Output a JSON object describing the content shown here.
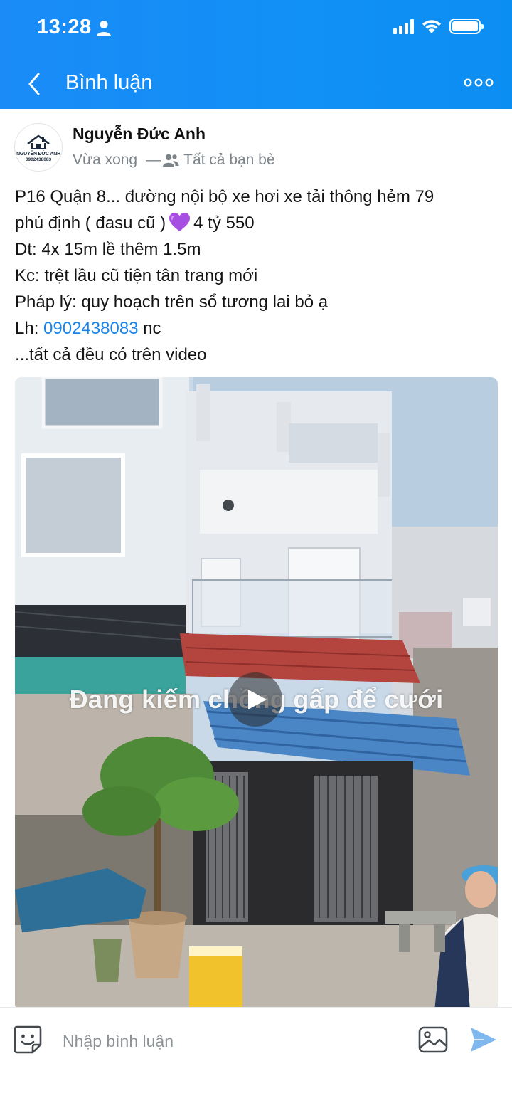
{
  "status_bar": {
    "time": "13:28"
  },
  "nav": {
    "title": "Bình luận"
  },
  "post": {
    "avatar": {
      "brand_text": "NGUYỄN ĐỨC ANH",
      "phone_text": "0902438083"
    },
    "author": "Nguyễn Đức Anh",
    "timestamp": "Vừa xong",
    "audience": "Tất cả bạn bè",
    "text": {
      "line1": "P16 Quận 8... đường nội bộ xe hơi xe tải thông hẻm 79",
      "line2_before": "phú định ( đasu cũ )",
      "line2_after": "4 tỷ 550",
      "line3": "Dt: 4x 15m lề thêm 1.5m",
      "line4": "Kc: trệt lầu cũ tiện tân trang mới",
      "line5": "Pháp lý: quy hoạch trên sổ tương lai bỏ ạ",
      "line6_prefix": "Lh: ",
      "phone": "0902438083",
      "line6_suffix": " nc",
      "line7": "...tất cả đều có trên video"
    },
    "video": {
      "caption": "Đang kiếm chồng gấp để cưới"
    }
  },
  "comment_bar": {
    "placeholder": "Nhập bình luận"
  },
  "colors": {
    "header_blue": "#1190f5",
    "link_blue": "#1a84e8",
    "heart_purple": "#a64fe0",
    "send_blue": "#7fb8ef"
  },
  "icons": [
    "back-chevron-icon",
    "more-dots-icon",
    "person-icon",
    "signal-icon",
    "wifi-icon",
    "battery-icon",
    "friends-icon",
    "heart-emoji",
    "play-icon",
    "sticker-icon",
    "image-icon",
    "send-icon"
  ]
}
